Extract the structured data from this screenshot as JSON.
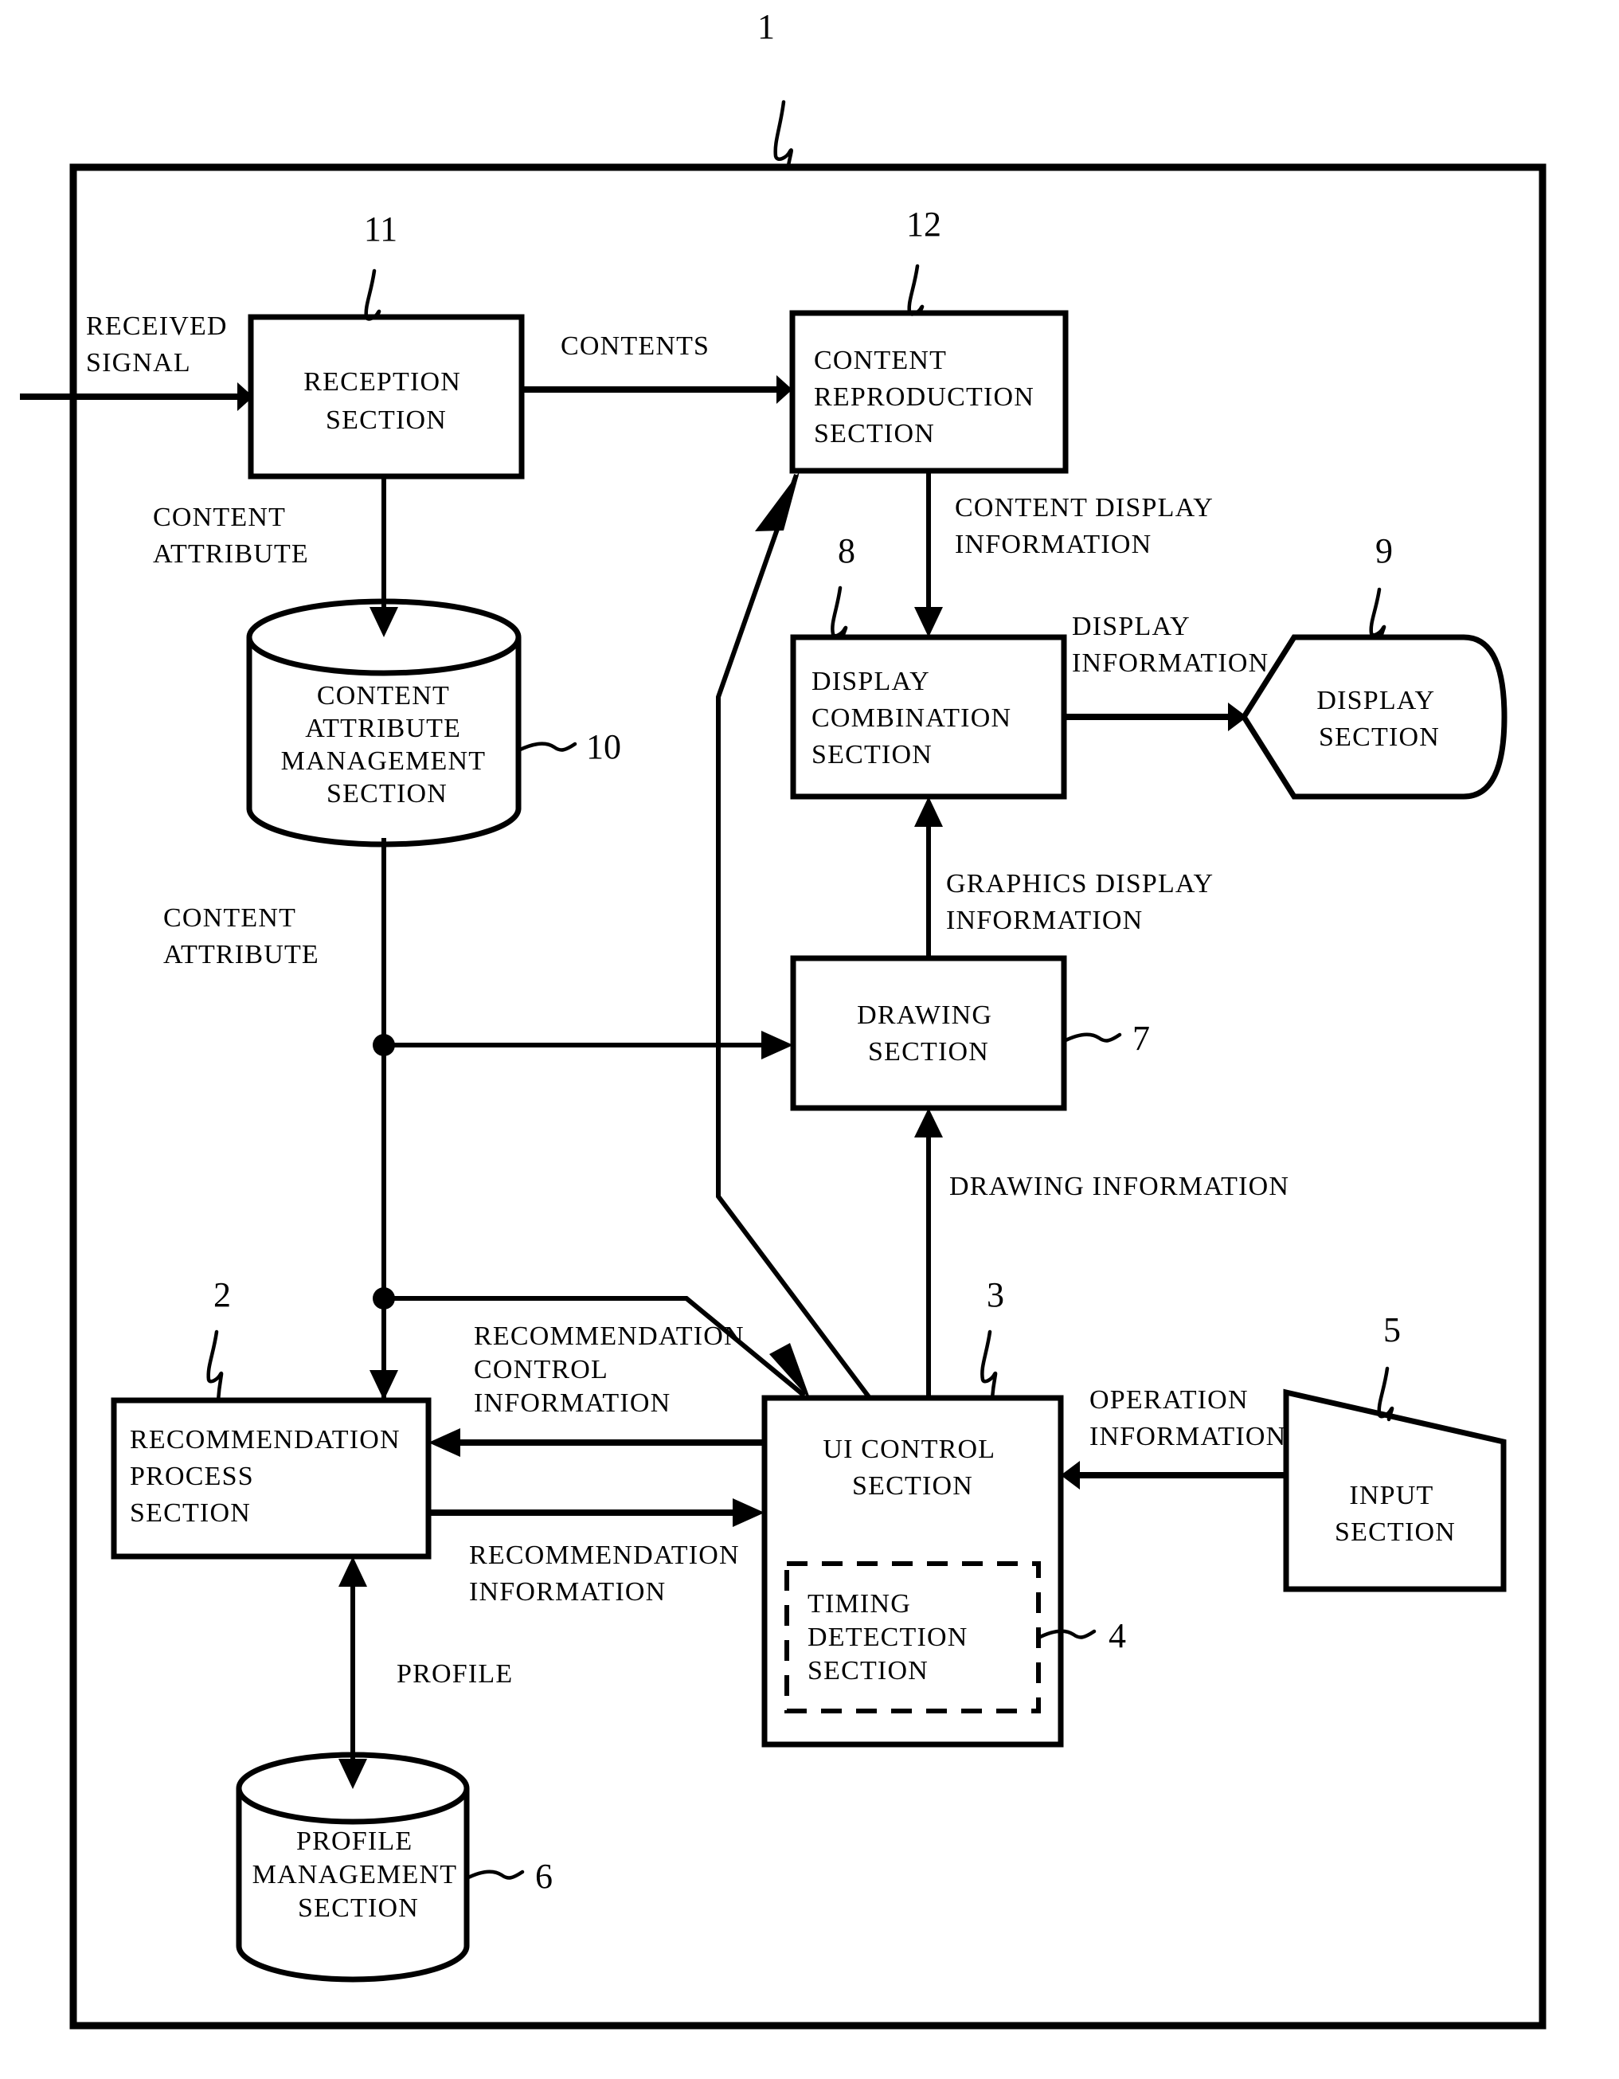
{
  "figure": {
    "system_ref": "1"
  },
  "blocks": {
    "reception": {
      "ref": "11",
      "lines": [
        "RECEPTION",
        "SECTION"
      ]
    },
    "content_reproduction": {
      "ref": "12",
      "lines": [
        "CONTENT",
        "REPRODUCTION",
        "SECTION"
      ]
    },
    "content_attribute_management": {
      "ref": "10",
      "lines": [
        "CONTENT",
        "ATTRIBUTE",
        "MANAGEMENT",
        "SECTION"
      ]
    },
    "display_combination": {
      "ref": "8",
      "lines": [
        "DISPLAY",
        "COMBINATION",
        "SECTION"
      ]
    },
    "display": {
      "ref": "9",
      "lines": [
        "DISPLAY",
        "SECTION"
      ]
    },
    "drawing": {
      "ref": "7",
      "lines": [
        "DRAWING",
        "SECTION"
      ]
    },
    "recommendation_process": {
      "ref": "2",
      "lines": [
        "RECOMMENDATION",
        "PROCESS",
        "SECTION"
      ]
    },
    "ui_control": {
      "ref": "3",
      "lines": [
        "UI CONTROL",
        "SECTION"
      ]
    },
    "timing_detection": {
      "ref": "4",
      "lines": [
        "TIMING",
        "DETECTION",
        "SECTION"
      ]
    },
    "input": {
      "ref": "5",
      "lines": [
        "INPUT",
        "SECTION"
      ]
    },
    "profile_management": {
      "ref": "6",
      "lines": [
        "PROFILE",
        "MANAGEMENT",
        "SECTION"
      ]
    }
  },
  "edge_labels": {
    "received_signal": [
      "RECEIVED",
      "SIGNAL"
    ],
    "contents": [
      "CONTENTS"
    ],
    "content_attribute_top": [
      "CONTENT",
      "ATTRIBUTE"
    ],
    "content_attribute_bottom": [
      "CONTENT",
      "ATTRIBUTE"
    ],
    "content_display_information": [
      "CONTENT DISPLAY",
      "INFORMATION"
    ],
    "display_information": [
      "DISPLAY",
      "INFORMATION"
    ],
    "graphics_display_information": [
      "GRAPHICS DISPLAY",
      "INFORMATION"
    ],
    "drawing_information": [
      "DRAWING INFORMATION"
    ],
    "recommendation_control_information": [
      "RECOMMENDATION",
      "CONTROL",
      "INFORMATION"
    ],
    "recommendation_information": [
      "RECOMMENDATION",
      "INFORMATION"
    ],
    "operation_information": [
      "OPERATION",
      "INFORMATION"
    ],
    "profile": [
      "PROFILE"
    ]
  }
}
